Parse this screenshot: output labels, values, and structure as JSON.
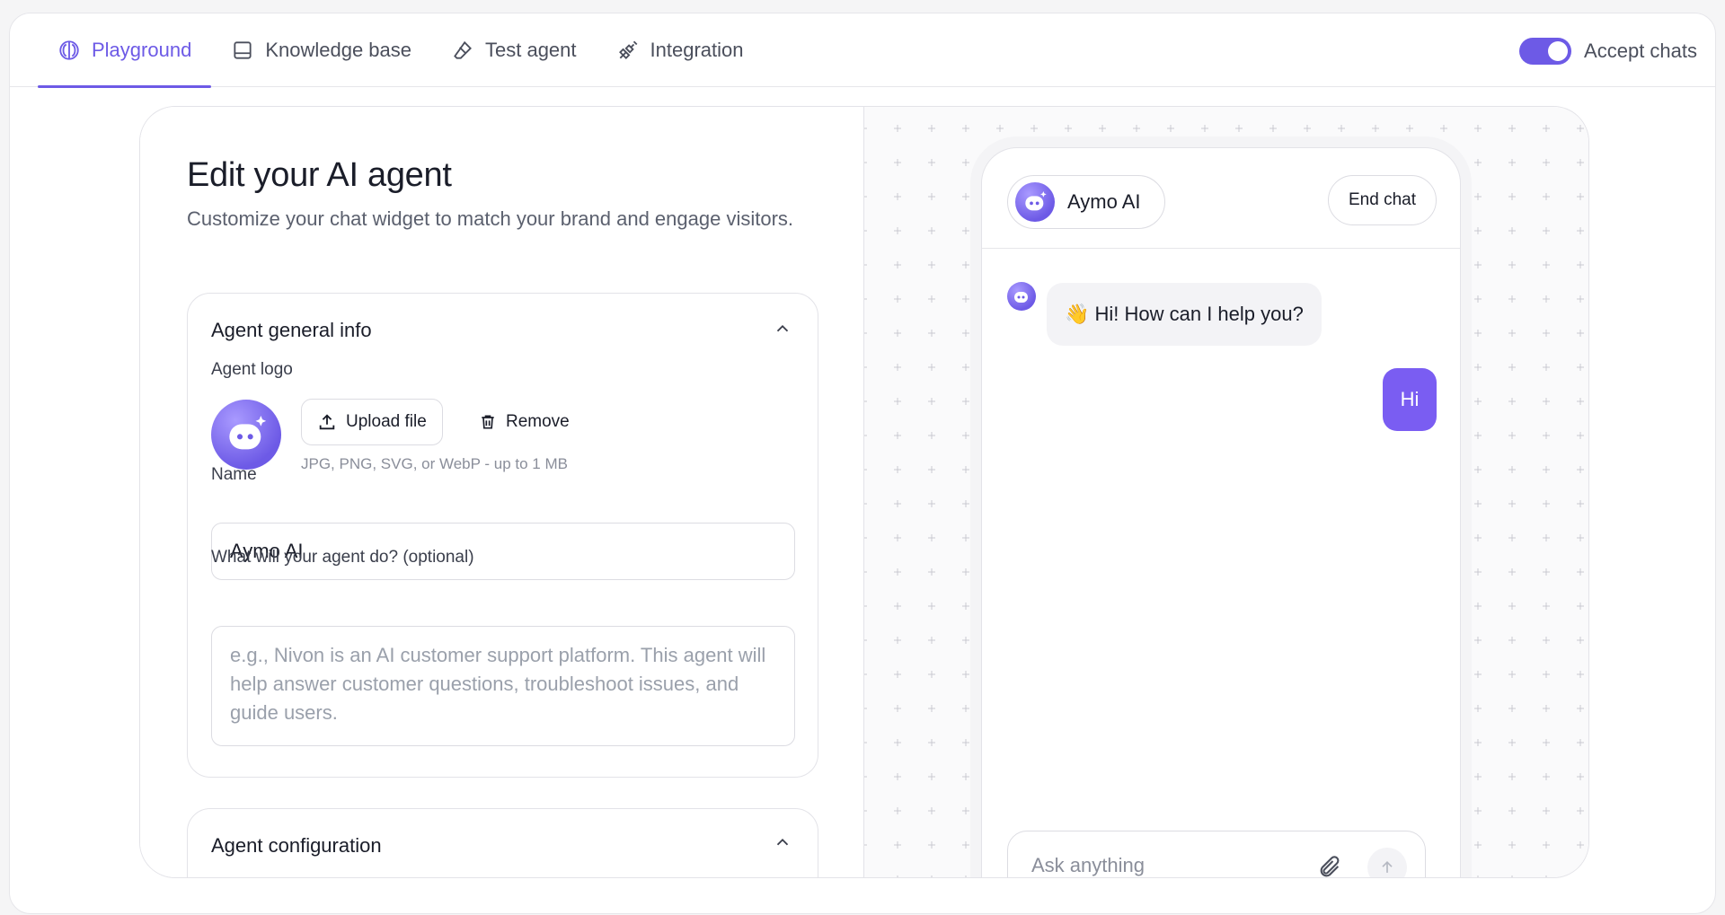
{
  "tabs": [
    {
      "label": "Playground",
      "icon": "brain-icon",
      "active": true
    },
    {
      "label": "Knowledge base",
      "icon": "book-icon",
      "active": false
    },
    {
      "label": "Test agent",
      "icon": "eraser-icon",
      "active": false
    },
    {
      "label": "Integration",
      "icon": "plug-icon",
      "active": false
    }
  ],
  "accept_chats": {
    "label": "Accept chats",
    "enabled": true
  },
  "editor": {
    "title": "Edit your AI agent",
    "subtitle": "Customize your chat widget to match your brand and engage visitors.",
    "general": {
      "heading": "Agent general info",
      "logo_label": "Agent logo",
      "upload_label": "Upload file",
      "remove_label": "Remove",
      "hint": "JPG, PNG, SVG, or WebP - up to 1 MB",
      "name_label": "Name",
      "name_value": "Aymo AI",
      "desc_label": "What will your agent do? (optional)",
      "desc_placeholder": "e.g., Nivon is an AI customer support platform. This agent will help answer customer questions, troubleshoot issues, and guide users."
    },
    "config": {
      "heading": "Agent configuration"
    }
  },
  "preview": {
    "agent_name": "Aymo AI",
    "end_chat_label": "End chat",
    "bot_message": "👋 Hi! How can I help you?",
    "user_message": "Hi",
    "composer_placeholder": "Ask anything"
  },
  "colors": {
    "accent": "#6d5ae6",
    "user_bubble": "#7a5df2"
  }
}
